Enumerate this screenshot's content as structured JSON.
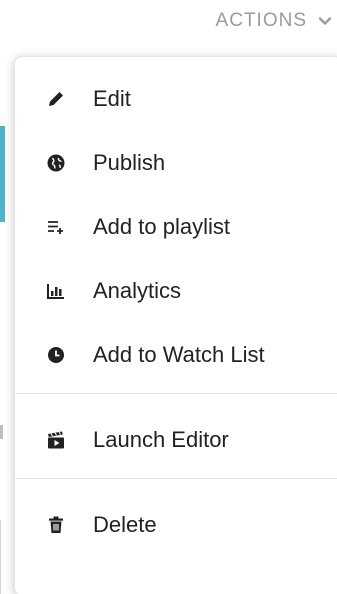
{
  "header": {
    "actions_label": "ACTIONS",
    "chevron_icon": "chevron-down-icon"
  },
  "menu": {
    "groups": [
      [
        {
          "label": "Edit",
          "icon": "pencil-icon"
        },
        {
          "label": "Publish",
          "icon": "globe-icon"
        },
        {
          "label": "Add to playlist",
          "icon": "playlist-add-icon"
        },
        {
          "label": "Analytics",
          "icon": "bar-chart-icon"
        },
        {
          "label": "Add to Watch List",
          "icon": "clock-icon"
        }
      ],
      [
        {
          "label": "Launch Editor",
          "icon": "clapperboard-icon"
        }
      ],
      [
        {
          "label": "Delete",
          "icon": "trash-icon"
        }
      ]
    ]
  },
  "colors": {
    "text": "#222222",
    "muted": "#9a9a9a",
    "accent": "#4fb3cc",
    "divider": "#e3e3e3"
  }
}
